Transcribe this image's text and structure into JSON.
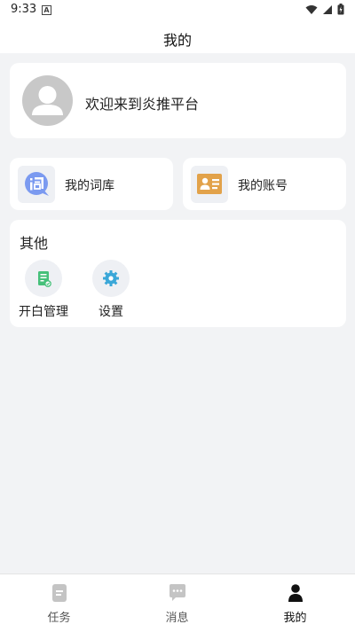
{
  "status": {
    "time": "9:33",
    "badge": "A"
  },
  "header": {
    "title": "我的"
  },
  "profile": {
    "welcome": "欢迎来到炎推平台"
  },
  "shortcuts": {
    "library": {
      "label": "我的词库"
    },
    "account": {
      "label": "我的账号"
    }
  },
  "other": {
    "heading": "其他",
    "items": [
      {
        "label": "开白管理",
        "icon": "document-check-icon"
      },
      {
        "label": "设置",
        "icon": "gear-icon"
      }
    ]
  },
  "tabs": [
    {
      "label": "任务",
      "icon": "task-icon",
      "active": false
    },
    {
      "label": "消息",
      "icon": "chat-icon",
      "active": false
    },
    {
      "label": "我的",
      "icon": "person-icon",
      "active": true
    }
  ],
  "colors": {
    "background": "#f2f3f5",
    "library_icon": "#7b9af0",
    "account_icon": "#e2a24a",
    "doc_icon": "#46c07a",
    "gear_icon": "#3aa7d8",
    "tab_inactive": "#c4c4c4",
    "tab_active": "#111111"
  }
}
